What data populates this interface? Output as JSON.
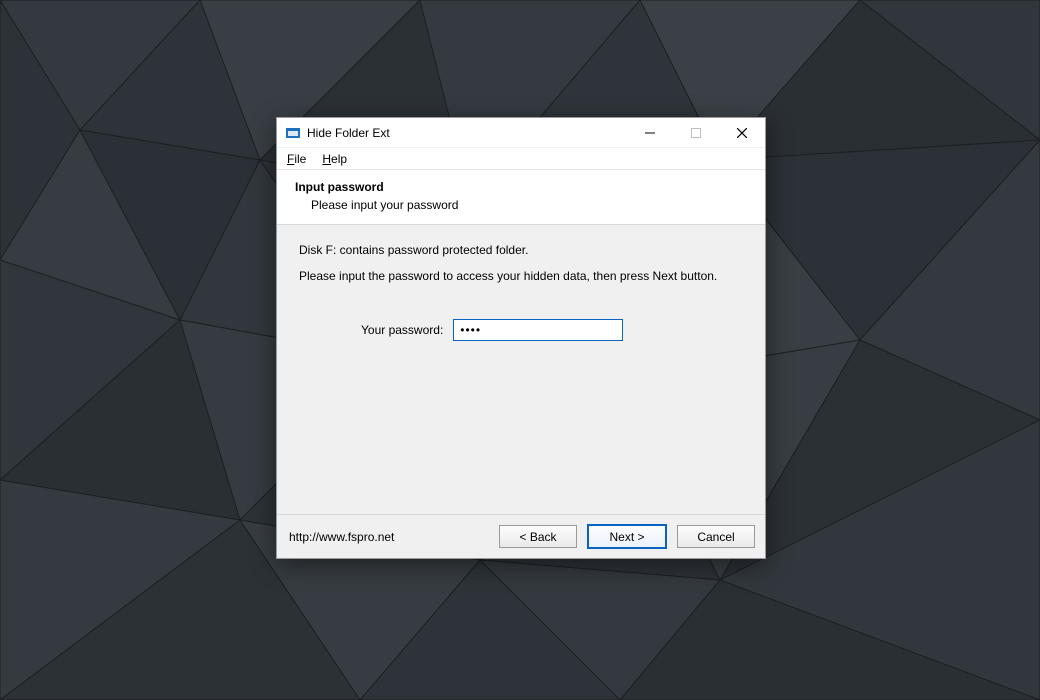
{
  "window": {
    "title": "Hide Folder Ext"
  },
  "menu": {
    "file": "File",
    "help": "Help"
  },
  "header": {
    "title": "Input password",
    "subtitle": "Please input your password"
  },
  "content": {
    "line1": "Disk F: contains password protected folder.",
    "line2": "Please input the password to access your hidden data, then press Next button.",
    "password_label": "Your password:",
    "password_value": "••••"
  },
  "footer": {
    "url": "http://www.fspro.net",
    "back": "< Back",
    "next": "Next >",
    "cancel": "Cancel"
  }
}
